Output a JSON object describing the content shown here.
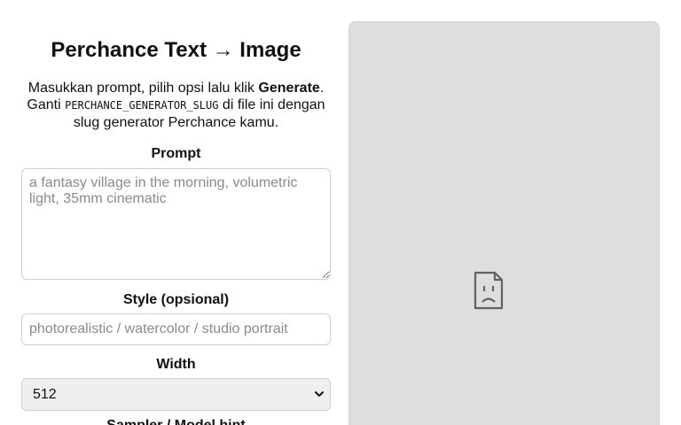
{
  "page": {
    "title": "Perchance Text → Image"
  },
  "description": {
    "part1": "Masukkan prompt, pilih opsi lalu klik ",
    "generate_word": "Generate",
    "part2": ". Ganti ",
    "code": "PERCHANCE_GENERATOR_SLUG",
    "part3": " di file ini dengan slug generator Perchance kamu."
  },
  "form": {
    "prompt_label": "Prompt",
    "prompt_placeholder": "a fantasy village in the morning, volumetric light, 35mm cinematic",
    "style_label": "Style (opsional)",
    "style_placeholder": "photorealistic / watercolor / studio portrait",
    "width_label": "Width",
    "width_value": "512",
    "sampler_label": "Sampler / Model hint"
  },
  "preview": {
    "icon": "broken-image-icon"
  }
}
